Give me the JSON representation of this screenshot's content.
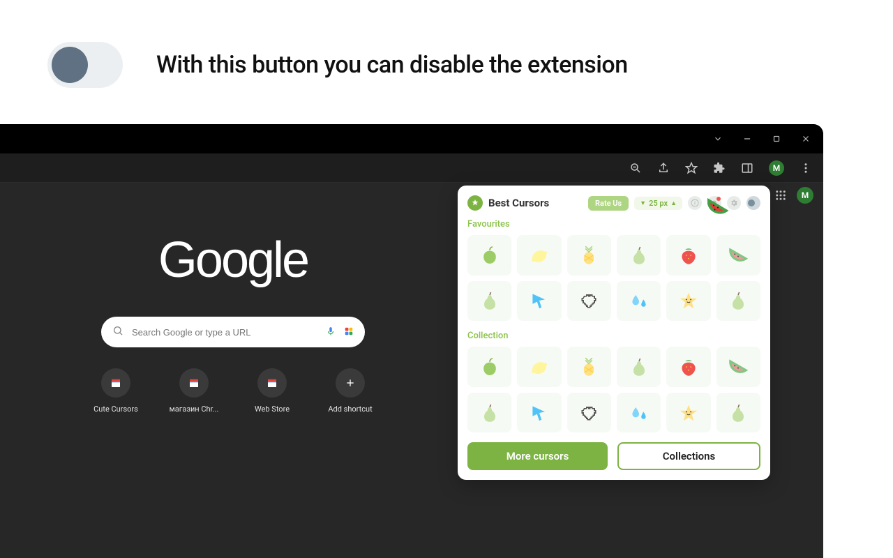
{
  "instruction": {
    "text": "With this button you can disable the extension"
  },
  "toolbar": {
    "avatar_initial": "M"
  },
  "ntp": {
    "logo": "Google",
    "search_placeholder": "Search Google or type a URL",
    "avatar_initial": "M",
    "shortcuts": [
      {
        "label": "Cute Cursors",
        "icon": "store"
      },
      {
        "label": "магазин Chr...",
        "icon": "store"
      },
      {
        "label": "Web Store",
        "icon": "store"
      },
      {
        "label": "Add shortcut",
        "icon": "plus"
      }
    ]
  },
  "extension": {
    "title": "Best Cursors",
    "rate_label": "Rate Us",
    "size_label": "25 px",
    "sections": {
      "favourites_title": "Favourites",
      "collection_title": "Collection"
    },
    "favourites": [
      {
        "name": "apple",
        "kind": "apple"
      },
      {
        "name": "lemon",
        "kind": "lemon"
      },
      {
        "name": "pineapple",
        "kind": "pineapple"
      },
      {
        "name": "pear-light",
        "kind": "pear"
      },
      {
        "name": "strawberry",
        "kind": "strawberry"
      },
      {
        "name": "watermelon",
        "kind": "watermelon"
      },
      {
        "name": "pear",
        "kind": "pear"
      },
      {
        "name": "arrow-cursor",
        "kind": "arrow"
      },
      {
        "name": "heart-pixel",
        "kind": "heart"
      },
      {
        "name": "water-drops",
        "kind": "drops"
      },
      {
        "name": "star",
        "kind": "star"
      },
      {
        "name": "pear-2",
        "kind": "pear"
      }
    ],
    "collection": [
      {
        "name": "apple",
        "kind": "apple"
      },
      {
        "name": "lemon",
        "kind": "lemon"
      },
      {
        "name": "pineapple",
        "kind": "pineapple"
      },
      {
        "name": "pear-light",
        "kind": "pear"
      },
      {
        "name": "strawberry",
        "kind": "strawberry"
      },
      {
        "name": "watermelon",
        "kind": "watermelon"
      },
      {
        "name": "pear",
        "kind": "pear"
      },
      {
        "name": "arrow-cursor",
        "kind": "arrow"
      },
      {
        "name": "heart-pixel",
        "kind": "heart"
      },
      {
        "name": "water-drops",
        "kind": "drops"
      },
      {
        "name": "star",
        "kind": "star"
      },
      {
        "name": "pear-2",
        "kind": "pear"
      }
    ],
    "footer": {
      "more_label": "More cursors",
      "collections_label": "Collections"
    }
  }
}
